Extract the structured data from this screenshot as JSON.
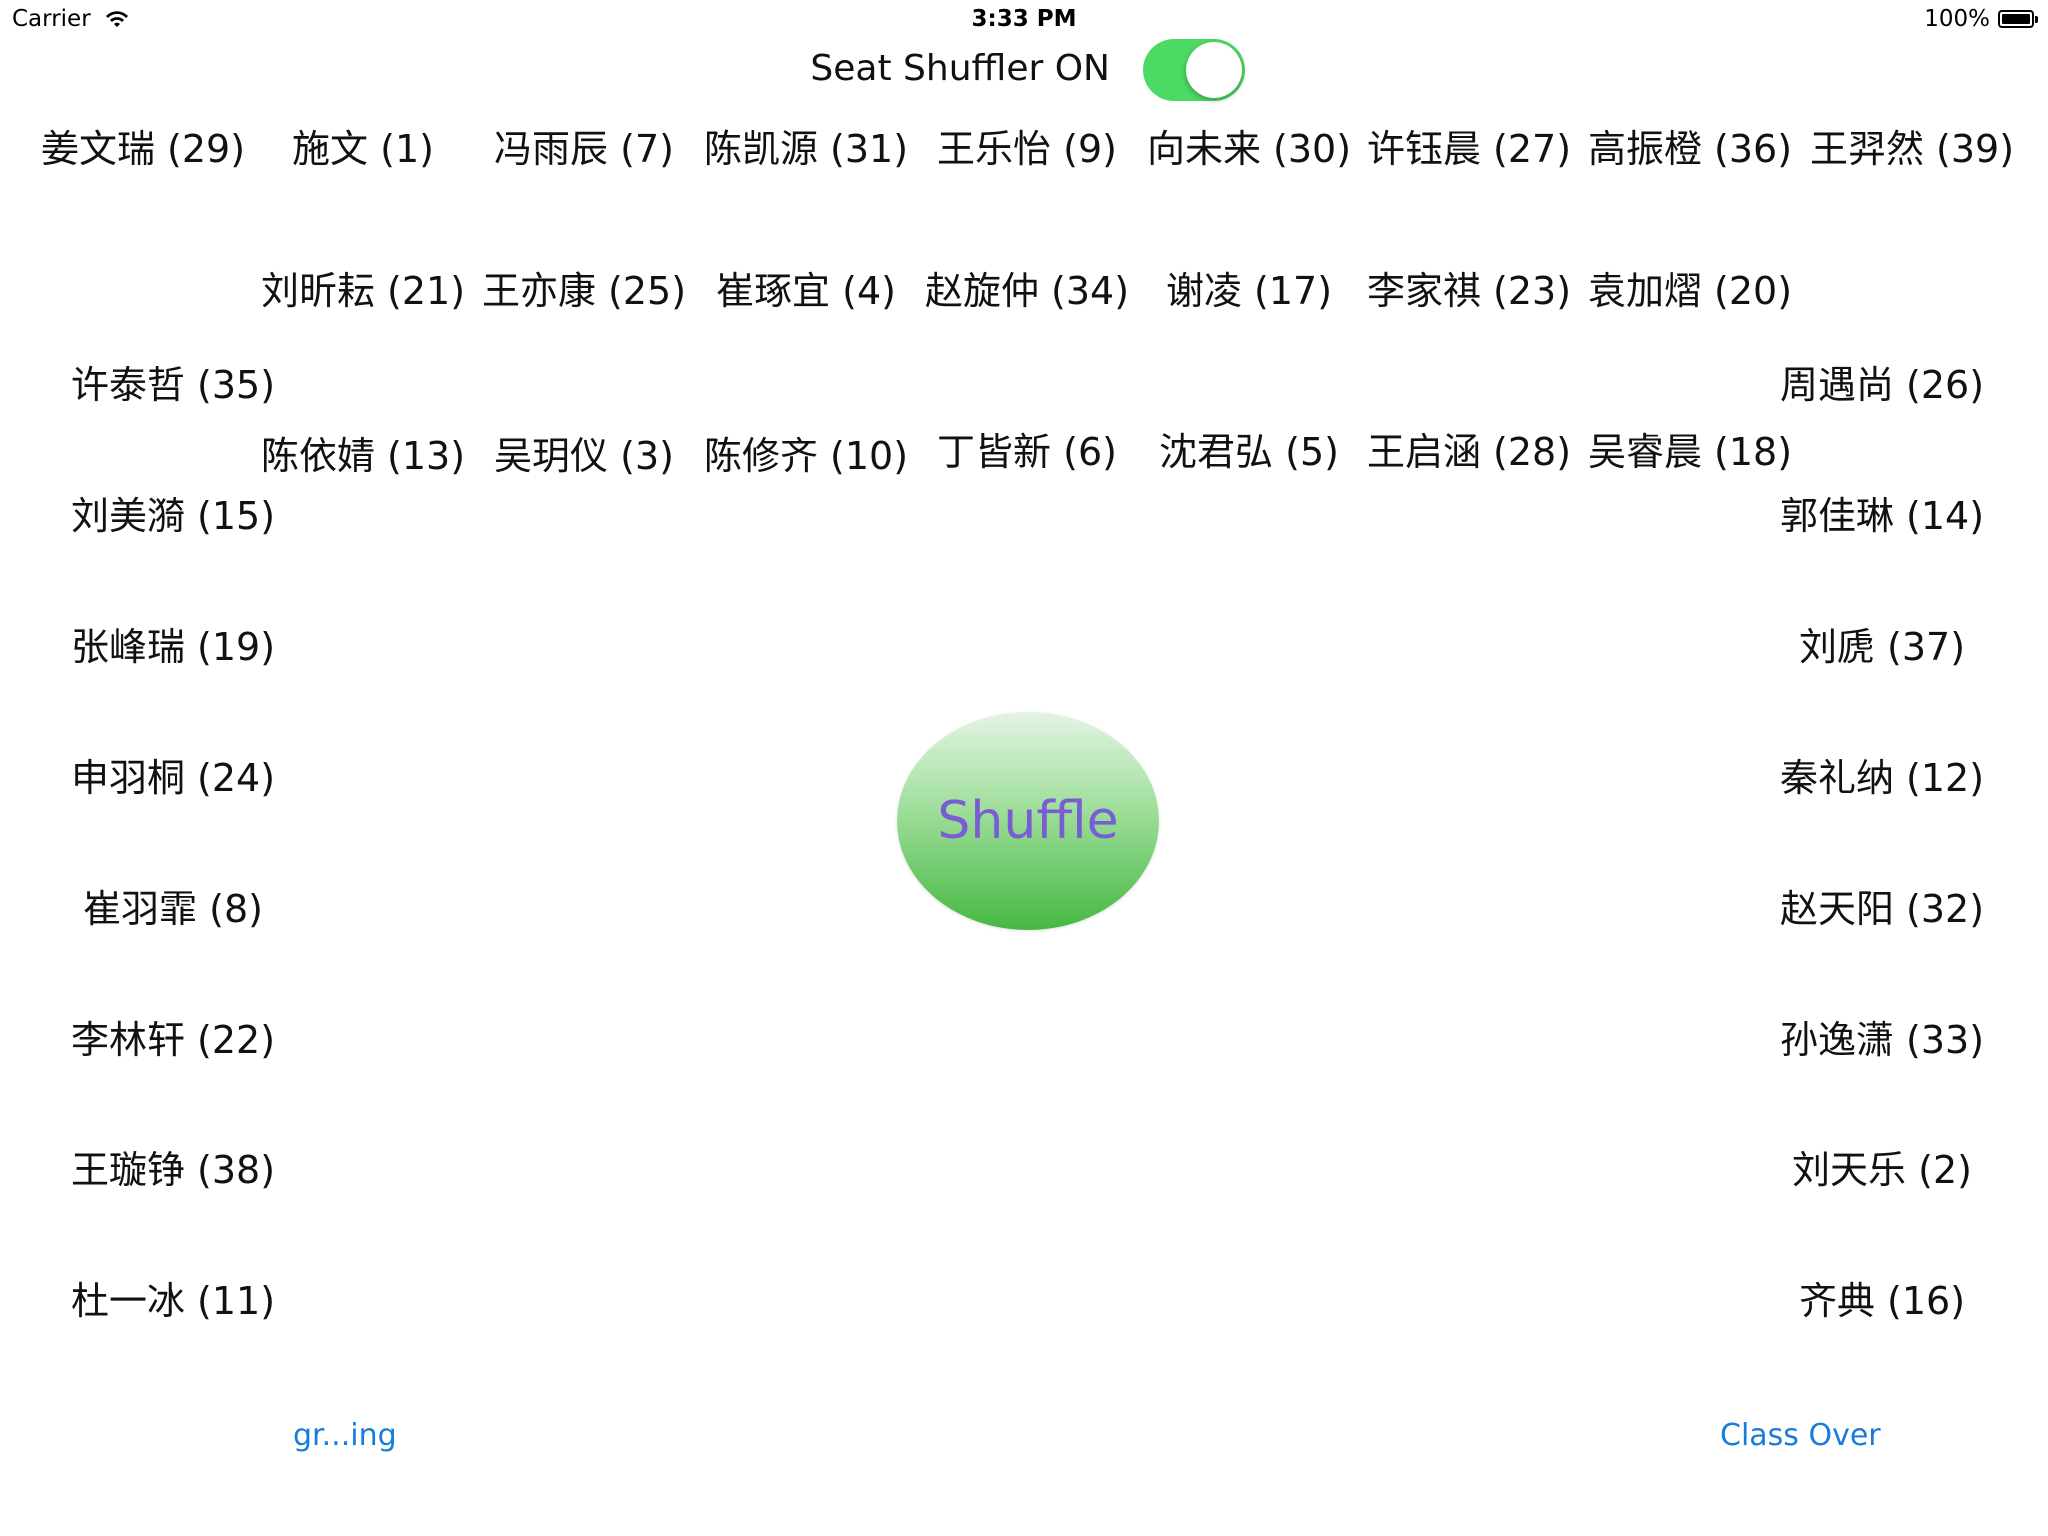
{
  "status_bar": {
    "carrier": "Carrier",
    "time": "3:33 PM",
    "battery": "100%"
  },
  "header": {
    "title": "Seat Shuffler ON",
    "toggle_on": true,
    "toggle_color": "#4cd964"
  },
  "row1": [
    "姜文瑞 (29)",
    "施文 (1)",
    "冯雨辰 (7)",
    "陈凯源 (31)",
    "王乐怡 (9)",
    "向未来 (30)",
    "许钰晨 (27)",
    "高振橙 (36)",
    "王羿然 (39)"
  ],
  "row2": [
    "刘昕耘 (21)",
    "王亦康 (25)",
    "崔琢宜 (4)",
    "赵旋仲 (34)",
    "谢凌 (17)",
    "李家祺 (23)",
    "袁加熠 (20)"
  ],
  "row3": [
    "陈依婧 (13)",
    "吴玥仪 (3)",
    "陈修齐 (10)",
    "丁皆新 (6)",
    "沈君弘 (5)",
    "王启涵 (28)",
    "吴睿晨 (18)"
  ],
  "left_column": [
    "许泰哲 (35)",
    "刘美漪 (15)",
    "张峰瑞 (19)",
    "申羽桐 (24)",
    "崔羽霏 (8)",
    "李林轩 (22)",
    "王璇铮 (38)",
    "杜一冰 (11)"
  ],
  "right_column": [
    "周遇尚 (26)",
    "郭佳琳 (14)",
    "刘虒 (37)",
    "秦礼纳 (12)",
    "赵天阳 (32)",
    "孙逸潇 (33)",
    "刘天乐 (2)",
    "齐典 (16)"
  ],
  "shuffle_button": {
    "label": "Shuffle",
    "label_color": "#7a5cd6"
  },
  "footer": {
    "left_link": "gr...ing",
    "right_link": "Class Over",
    "link_color": "#1a7cd9"
  }
}
